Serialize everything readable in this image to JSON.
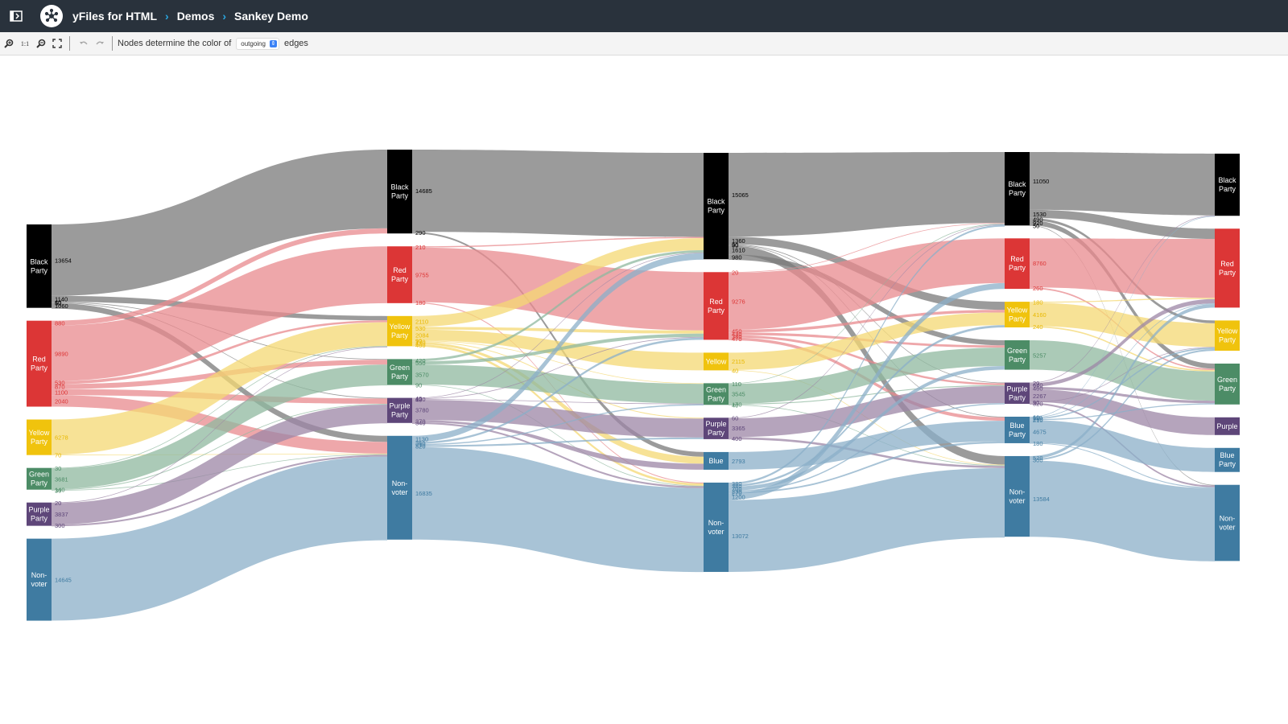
{
  "header": {
    "breadcrumbs": [
      "yFiles for HTML",
      "Demos",
      "Sankey Demo"
    ]
  },
  "toolbar": {
    "zoom_in": "zoom-in",
    "zoom_reset": "1:1",
    "zoom_out": "zoom-out",
    "fit": "fit",
    "undo": "undo",
    "redo": "redo",
    "color_prefix": "Nodes determine the color of",
    "color_mode": "outgoing",
    "color_suffix": "edges"
  },
  "colors": {
    "Black": "#000000",
    "Red": "#dc3636",
    "Yellow": "#f0c30d",
    "Green": "#4c8c66",
    "Purple": "#5e4679",
    "Blue": "#3f7ba1",
    "Non": "#3f7ba1",
    "flow_Black": "#7a7a7a",
    "flow_Red": "#e88a8d",
    "flow_Yellow": "#f4d873",
    "flow_Green": "#8fb89f",
    "flow_Purple": "#9c86a5",
    "flow_Blue": "#8bafc8",
    "flow_Non": "#8bafc8",
    "label_Black": "#000000",
    "label_Red": "#dc3636",
    "label_Yellow": "#e8b800",
    "label_Green": "#4c8c66",
    "label_Purple": "#5e4679",
    "label_Blue": "#3f7ba1",
    "label_Non": "#3f7ba1"
  },
  "chart_data": {
    "type": "sankey",
    "columns": [
      [
        {
          "id": "c0_black",
          "party": "Black",
          "label": "Black\nParty",
          "size": 14894
        },
        {
          "id": "c0_red",
          "party": "Red",
          "label": "Red\nParty",
          "size": 15350
        },
        {
          "id": "c0_yellow",
          "party": "Yellow",
          "label": "Yellow\nParty",
          "size": 6348
        },
        {
          "id": "c0_green",
          "party": "Green",
          "label": "Green\nParty",
          "size": 3881
        },
        {
          "id": "c0_purple",
          "party": "Purple",
          "label": "Purple\nParty",
          "size": 4157
        },
        {
          "id": "c0_non",
          "party": "Non",
          "label": "Non-\nvoter",
          "size": 14645
        }
      ],
      [
        {
          "id": "c1_black",
          "party": "Black",
          "label": "Black\nParty",
          "size": 14975
        },
        {
          "id": "c1_red",
          "party": "Red",
          "label": "Red\nParty",
          "size": 10145
        },
        {
          "id": "c1_yellow",
          "party": "Yellow",
          "label": "Yellow\nParty",
          "size": 5394
        },
        {
          "id": "c1_green",
          "party": "Green",
          "label": "Green\nParty",
          "size": 4630
        },
        {
          "id": "c1_purple",
          "party": "Purple",
          "label": "Purple\nParty",
          "size": 4480
        },
        {
          "id": "c1_non",
          "party": "Non",
          "label": "Non-\nvoter",
          "size": 18535
        }
      ],
      [
        {
          "id": "c2_black",
          "party": "Black",
          "label": "Black\nParty",
          "size": 19005
        },
        {
          "id": "c2_red",
          "party": "Red",
          "label": "Red\nParty",
          "size": 12086
        },
        {
          "id": "c2_yellow",
          "party": "Yellow",
          "label": "Yellow",
          "size": 2155
        },
        {
          "id": "c2_green",
          "party": "Green",
          "label": "Green\nParty",
          "size": 3865
        },
        {
          "id": "c2_purple",
          "party": "Purple",
          "label": "Purple\nParty",
          "size": 3825
        },
        {
          "id": "c2_blue",
          "party": "Blue",
          "label": "Blue",
          "size": 2793
        },
        {
          "id": "c2_non",
          "party": "Non",
          "label": "Non-\nvoter",
          "size": 15952
        }
      ],
      [
        {
          "id": "c3_black",
          "party": "Black",
          "label": "Black\nParty",
          "size": 13120
        },
        {
          "id": "c3_red",
          "party": "Red",
          "label": "Red\nParty",
          "size": 9020
        },
        {
          "id": "c3_yellow",
          "party": "Yellow",
          "label": "Yellow\nParty",
          "size": 4580
        },
        {
          "id": "c3_green",
          "party": "Green",
          "label": "Green\nParty",
          "size": 5257
        },
        {
          "id": "c3_purple",
          "party": "Purple",
          "label": "Purple\nParty",
          "size": 3797
        },
        {
          "id": "c3_blue",
          "party": "Blue",
          "label": "Blue\nParty",
          "size": 4735
        },
        {
          "id": "c3_non",
          "party": "Non",
          "label": "Non-\nvoter",
          "size": 14404
        }
      ],
      [
        {
          "id": "c4_black",
          "party": "Black",
          "label": "Black\nParty",
          "size": 11100
        },
        {
          "id": "c4_red",
          "party": "Red",
          "label": "Red\nParty",
          "size": 14100
        },
        {
          "id": "c4_yellow",
          "party": "Yellow",
          "label": "Yellow\nParty",
          "size": 5400
        },
        {
          "id": "c4_green",
          "party": "Green",
          "label": "Green\nParty",
          "size": 7300
        },
        {
          "id": "c4_purple",
          "party": "Purple",
          "label": "Purple",
          "size": 2400
        },
        {
          "id": "c4_blue",
          "party": "Blue",
          "label": "Blue\nParty",
          "size": 4300
        },
        {
          "id": "c4_non",
          "party": "Non",
          "label": "Non-\nvoter",
          "size": 13600
        }
      ]
    ],
    "flows": [
      {
        "from": "c0_black",
        "to": "c1_black",
        "value": 13654
      },
      {
        "from": "c0_black",
        "to": "c1_yellow",
        "value": 1140
      },
      {
        "from": "c0_black",
        "to": "c1_green",
        "value": 40
      },
      {
        "from": "c0_black",
        "to": "c1_purple",
        "value": 50
      },
      {
        "from": "c0_black",
        "to": "c1_non",
        "value": 1060
      },
      {
        "from": "c0_red",
        "to": "c1_black",
        "value": 880
      },
      {
        "from": "c0_red",
        "to": "c1_red",
        "value": 9890
      },
      {
        "from": "c0_red",
        "to": "c1_yellow",
        "value": 530
      },
      {
        "from": "c0_red",
        "to": "c1_green",
        "value": 870
      },
      {
        "from": "c0_red",
        "to": "c1_purple",
        "value": 1100
      },
      {
        "from": "c0_red",
        "to": "c1_non",
        "value": 2040
      },
      {
        "from": "c0_yellow",
        "to": "c1_yellow",
        "value": 6278
      },
      {
        "from": "c0_yellow",
        "to": "c1_non",
        "value": 70
      },
      {
        "from": "c0_green",
        "to": "c1_yellow",
        "value": 30
      },
      {
        "from": "c0_green",
        "to": "c1_green",
        "value": 3681
      },
      {
        "from": "c0_green",
        "to": "c1_purple",
        "value": 140
      },
      {
        "from": "c0_green",
        "to": "c1_non",
        "value": 30
      },
      {
        "from": "c0_purple",
        "to": "c1_yellow",
        "value": 20
      },
      {
        "from": "c0_purple",
        "to": "c1_purple",
        "value": 3837
      },
      {
        "from": "c0_purple",
        "to": "c1_non",
        "value": 300
      },
      {
        "from": "c0_non",
        "to": "c1_non",
        "value": 14645
      },
      {
        "from": "c1_black",
        "to": "c2_black",
        "value": 14685
      },
      {
        "from": "c1_black",
        "to": "c2_blue",
        "value": 290
      },
      {
        "from": "c1_red",
        "to": "c2_black",
        "value": 210
      },
      {
        "from": "c1_red",
        "to": "c2_red",
        "value": 9755
      },
      {
        "from": "c1_red",
        "to": "c2_non",
        "value": 180
      },
      {
        "from": "c1_yellow",
        "to": "c2_black",
        "value": 2110
      },
      {
        "from": "c1_yellow",
        "to": "c2_red",
        "value": 530
      },
      {
        "from": "c1_yellow",
        "to": "c2_yellow",
        "value": 2084
      },
      {
        "from": "c1_yellow",
        "to": "c2_green",
        "value": 90
      },
      {
        "from": "c1_yellow",
        "to": "c2_purple",
        "value": 170
      },
      {
        "from": "c1_yellow",
        "to": "c2_blue",
        "value": 430
      },
      {
        "from": "c1_yellow",
        "to": "c2_non",
        "value": 460
      },
      {
        "from": "c1_green",
        "to": "c2_black",
        "value": 420
      },
      {
        "from": "c1_green",
        "to": "c2_red",
        "value": 550
      },
      {
        "from": "c1_green",
        "to": "c2_green",
        "value": 3570
      },
      {
        "from": "c1_green",
        "to": "c2_non",
        "value": 90
      },
      {
        "from": "c1_purple",
        "to": "c2_black",
        "value": 40
      },
      {
        "from": "c1_purple",
        "to": "c2_red",
        "value": 120
      },
      {
        "from": "c1_purple",
        "to": "c2_green",
        "value": 40
      },
      {
        "from": "c1_purple",
        "to": "c2_purple",
        "value": 3780
      },
      {
        "from": "c1_purple",
        "to": "c2_blue",
        "value": 370
      },
      {
        "from": "c1_purple",
        "to": "c2_non",
        "value": 340
      },
      {
        "from": "c1_non",
        "to": "c2_black",
        "value": 1130
      },
      {
        "from": "c1_non",
        "to": "c2_red",
        "value": 360
      },
      {
        "from": "c1_non",
        "to": "c2_green",
        "value": 210
      },
      {
        "from": "c1_non",
        "to": "c2_purple",
        "value": 320
      },
      {
        "from": "c1_non",
        "to": "c2_non",
        "value": 16835
      },
      {
        "from": "c2_black",
        "to": "c3_black",
        "value": 15065
      },
      {
        "from": "c2_black",
        "to": "c3_yellow",
        "value": 1360
      },
      {
        "from": "c2_black",
        "to": "c3_purple",
        "value": 30
      },
      {
        "from": "c2_black",
        "to": "c3_blue",
        "value": 90
      },
      {
        "from": "c2_black",
        "to": "c3_non",
        "value": 1610
      },
      {
        "from": "c2_black",
        "to": "c3_green",
        "value": 980
      },
      {
        "from": "c2_red",
        "to": "c3_black",
        "value": 20
      },
      {
        "from": "c2_red",
        "to": "c3_red",
        "value": 9276
      },
      {
        "from": "c2_red",
        "to": "c3_yellow",
        "value": 450
      },
      {
        "from": "c2_red",
        "to": "c3_green",
        "value": 430
      },
      {
        "from": "c2_red",
        "to": "c3_purple",
        "value": 380
      },
      {
        "from": "c2_red",
        "to": "c3_blue",
        "value": 470
      },
      {
        "from": "c2_yellow",
        "to": "c3_yellow",
        "value": 2115
      },
      {
        "from": "c2_yellow",
        "to": "c3_non",
        "value": 40
      },
      {
        "from": "c2_green",
        "to": "c3_black",
        "value": 110
      },
      {
        "from": "c2_green",
        "to": "c3_green",
        "value": 3545
      },
      {
        "from": "c2_green",
        "to": "c3_purple",
        "value": 170
      },
      {
        "from": "c2_green",
        "to": "c3_non",
        "value": 40
      },
      {
        "from": "c2_purple",
        "to": "c3_black",
        "value": 60
      },
      {
        "from": "c2_purple",
        "to": "c3_purple",
        "value": 3365
      },
      {
        "from": "c2_purple",
        "to": "c3_non",
        "value": 400
      },
      {
        "from": "c2_blue",
        "to": "c3_blue",
        "value": 2793
      },
      {
        "from": "c2_non",
        "to": "c3_black",
        "value": 380
      },
      {
        "from": "c2_non",
        "to": "c3_yellow",
        "value": 380
      },
      {
        "from": "c2_non",
        "to": "c3_green",
        "value": 700
      },
      {
        "from": "c2_non",
        "to": "c3_purple",
        "value": 230
      },
      {
        "from": "c2_non",
        "to": "c3_blue",
        "value": 270
      },
      {
        "from": "c2_non",
        "to": "c3_red",
        "value": 1200
      },
      {
        "from": "c2_non",
        "to": "c3_non",
        "value": 13072
      },
      {
        "from": "c3_black",
        "to": "c4_black",
        "value": 11050
      },
      {
        "from": "c3_black",
        "to": "c4_red",
        "value": 1530
      },
      {
        "from": "c3_black",
        "to": "c4_yellow",
        "value": 490
      },
      {
        "from": "c3_black",
        "to": "c4_green",
        "value": 920
      },
      {
        "from": "c3_black",
        "to": "c4_non",
        "value": 50
      },
      {
        "from": "c3_red",
        "to": "c4_red",
        "value": 8760
      },
      {
        "from": "c3_red",
        "to": "c4_green",
        "value": 260
      },
      {
        "from": "c3_yellow",
        "to": "c4_red",
        "value": 180
      },
      {
        "from": "c3_yellow",
        "to": "c4_yellow",
        "value": 4160
      },
      {
        "from": "c3_yellow",
        "to": "c4_green",
        "value": 240
      },
      {
        "from": "c3_green",
        "to": "c4_green",
        "value": 5257
      },
      {
        "from": "c3_purple",
        "to": "c4_black",
        "value": 20
      },
      {
        "from": "c3_purple",
        "to": "c4_red",
        "value": 640
      },
      {
        "from": "c3_purple",
        "to": "c4_green",
        "value": 460
      },
      {
        "from": "c3_purple",
        "to": "c4_purple",
        "value": 2267
      },
      {
        "from": "c3_purple",
        "to": "c4_yellow",
        "value": 90
      },
      {
        "from": "c3_purple",
        "to": "c4_non",
        "value": 320
      },
      {
        "from": "c3_blue",
        "to": "c4_black",
        "value": 60
      },
      {
        "from": "c3_blue",
        "to": "c4_red",
        "value": 110
      },
      {
        "from": "c3_blue",
        "to": "c4_yellow",
        "value": 260
      },
      {
        "from": "c3_blue",
        "to": "c4_green",
        "value": 210
      },
      {
        "from": "c3_blue",
        "to": "c4_blue",
        "value": 4675
      },
      {
        "from": "c3_blue",
        "to": "c4_non",
        "value": 180
      },
      {
        "from": "c3_non",
        "to": "c4_red",
        "value": 520
      },
      {
        "from": "c3_non",
        "to": "c4_yellow",
        "value": 300
      },
      {
        "from": "c3_non",
        "to": "c4_non",
        "value": 13584
      }
    ]
  }
}
